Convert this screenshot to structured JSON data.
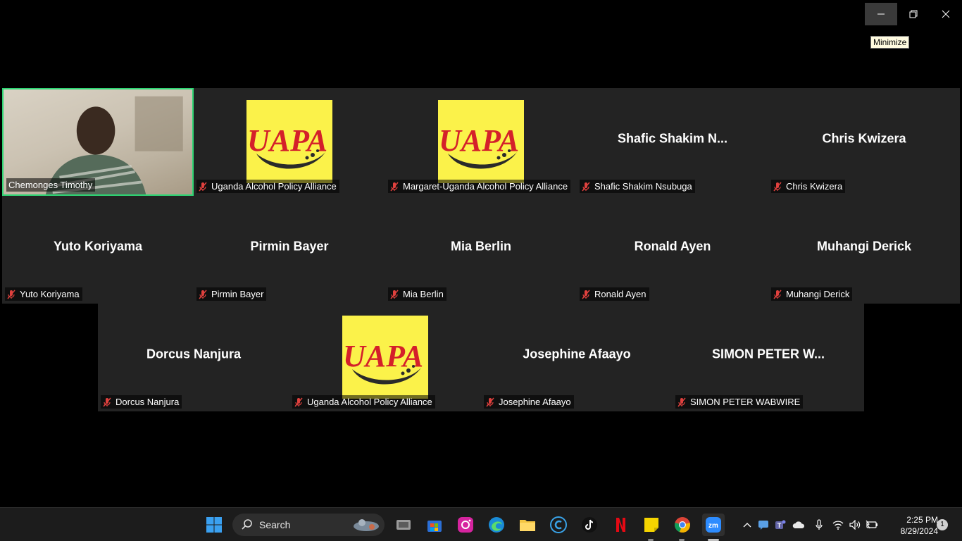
{
  "window": {
    "minimize_tooltip": "Minimize"
  },
  "gallery": {
    "row1": [
      {
        "label": "Chemonges Timothy",
        "display": "",
        "type": "video",
        "active": true
      },
      {
        "label": "Uganda Alcohol Policy Alliance",
        "display": "",
        "type": "logo"
      },
      {
        "label": "Margaret-Uganda Alcohol Policy Alliance",
        "display": "",
        "type": "logo"
      },
      {
        "label": "Shafic Shakim Nsubuga",
        "display": "Shafic Shakim N...",
        "type": "name"
      },
      {
        "label": "Chris Kwizera",
        "display": "Chris Kwizera",
        "type": "name"
      }
    ],
    "row2": [
      {
        "label": "Yuto Koriyama",
        "display": "Yuto Koriyama",
        "type": "name"
      },
      {
        "label": "Pirmin Bayer",
        "display": "Pirmin Bayer",
        "type": "name"
      },
      {
        "label": "Mia Berlin",
        "display": "Mia Berlin",
        "type": "name"
      },
      {
        "label": "Ronald Ayen",
        "display": "Ronald Ayen",
        "type": "name"
      },
      {
        "label": "Muhangi Derick",
        "display": "Muhangi Derick",
        "type": "name"
      }
    ],
    "row3": [
      {
        "label": "Dorcus Nanjura",
        "display": "Dorcus Nanjura",
        "type": "name"
      },
      {
        "label": "Uganda Alcohol Policy Alliance",
        "display": "",
        "type": "logo"
      },
      {
        "label": "Josephine Afaayo",
        "display": "Josephine Afaayo",
        "type": "name"
      },
      {
        "label": "SIMON PETER WABWIRE",
        "display": "SIMON PETER W...",
        "type": "name"
      }
    ],
    "logo_text": "UAPA",
    "colors": {
      "active_border": "#2ed573",
      "tile_bg": "#232323",
      "logo_bg": "#fbf24a",
      "logo_red": "#d4202a",
      "mute_red": "#e0413e"
    }
  },
  "taskbar": {
    "search_label": "Search",
    "apps": [
      "windows-start",
      "search",
      "task-view",
      "microsoft-store",
      "instagram",
      "edge",
      "file-explorer",
      "ccleaner",
      "tiktok",
      "netflix",
      "sticky-notes",
      "chrome",
      "zoom"
    ],
    "tray_icons": [
      "chevron-up",
      "chat",
      "teams",
      "onedrive",
      "microphone",
      "wifi",
      "volume",
      "battery"
    ],
    "time": "2:25 PM",
    "date": "8/29/2024",
    "notification_count": "1"
  }
}
